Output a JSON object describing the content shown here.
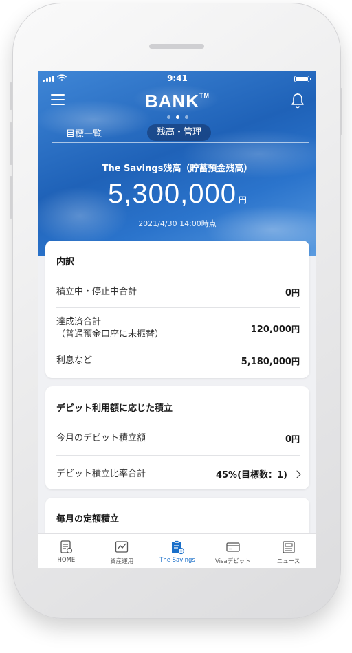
{
  "status_bar": {
    "time": "9:41"
  },
  "header": {
    "logo": "BANK",
    "logo_mark": "TM",
    "icons": {
      "menu": "hamburger-menu-icon",
      "notifications": "bell-icon"
    }
  },
  "tabs": [
    {
      "label": "目標一覧",
      "active": false
    },
    {
      "label": "残高・管理",
      "active": true
    }
  ],
  "balance": {
    "label": "The Savings残高（貯蓄預金残高）",
    "amount": "5,300,000",
    "unit": "円",
    "as_of": "2021/4/30 14:00時点"
  },
  "breakdown": {
    "title": "内訳",
    "rows": [
      {
        "label": "積立中・停止中合計",
        "value": "0",
        "unit": "円"
      },
      {
        "label": "達成済合計",
        "label_sub": "（普通預金口座に未振替）",
        "value": "120,000",
        "unit": "円"
      },
      {
        "label": "利息など",
        "value": "5,180,000",
        "unit": "円"
      }
    ]
  },
  "debit": {
    "title": "デビット利用額に応じた積立",
    "rows": [
      {
        "label": "今月のデビット積立額",
        "value": "0",
        "unit": "円"
      },
      {
        "label": "デビット積立比率合計",
        "value": "45%(目標数：1)"
      }
    ]
  },
  "monthly": {
    "title": "毎月の定額積立"
  },
  "bottom_nav": [
    {
      "label": "HOME",
      "icon": "home-document-icon",
      "active": false
    },
    {
      "label": "資産運用",
      "icon": "chart-icon",
      "active": false
    },
    {
      "label": "The Savings",
      "icon": "savings-clipboard-icon",
      "active": true
    },
    {
      "label": "Visaデビット",
      "icon": "card-icon",
      "active": false
    },
    {
      "label": "ニュース",
      "icon": "newspaper-icon",
      "active": false
    }
  ],
  "colors": {
    "accent": "#1a6fc9",
    "hero": "#2b6fc4",
    "background": "#f0f1f4"
  }
}
